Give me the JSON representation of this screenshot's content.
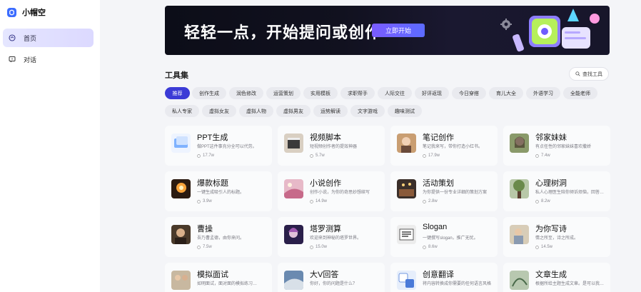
{
  "app": {
    "name": "小帽空"
  },
  "nav": [
    {
      "label": "首页",
      "icon": "home-icon",
      "active": true
    },
    {
      "label": "对话",
      "icon": "chat-icon",
      "active": false
    }
  ],
  "banner": {
    "title": "轻轻一点，开始提问或创作",
    "button": "立即开始"
  },
  "tools": {
    "title": "工具集",
    "search_label": "查找工具",
    "tags_row1": [
      "推荐",
      "创作生成",
      "润色修改",
      "运营策划",
      "实用模板",
      "求职帮手",
      "人际交往",
      "好评返现",
      "今日穿搭",
      "育儿大全",
      "外语学习",
      "全能老师"
    ],
    "tags_row2": [
      "私人专家",
      "虚拟女友",
      "虚拟人物",
      "虚拟男友",
      "运势解读",
      "文字游戏",
      "趣味测试"
    ],
    "cards": [
      {
        "title": "PPT生成",
        "desc": "做PPT这件事充分全可以代劳。",
        "count": "17.7w"
      },
      {
        "title": "视频脚本",
        "desc": "短视频创作者的提效神器",
        "count": "5.7w"
      },
      {
        "title": "笔记创作",
        "desc": "笔记我来写，带你打造小红书。",
        "count": "17.9w"
      },
      {
        "title": "邻家妹妹",
        "desc": "有点任性的邻家妹妹喜欢撒娇",
        "count": "7.4w"
      },
      {
        "title": "爆款标题",
        "desc": "一键生成吸引人的标题。",
        "count": "3.9w"
      },
      {
        "title": "小说创作",
        "desc": "创作小说，为你的奇思妙想续写",
        "count": "14.9w"
      },
      {
        "title": "活动策划",
        "desc": "为你提供一份专业详细的策划方案",
        "count": "2.8w"
      },
      {
        "title": "心理树洞",
        "desc": "私人心理医生陪你倾诉烦恼，回答…",
        "count": "8.2w"
      },
      {
        "title": "曹操",
        "desc": "吾乃曹孟德，由你来问。",
        "count": "7.5w"
      },
      {
        "title": "塔罗测算",
        "desc": "欢迎来到神秘的塔罗世界。",
        "count": "15.0w"
      },
      {
        "title": "Slogan",
        "desc": "一键撰写slogan，推广无忧。",
        "count": "8.6w"
      },
      {
        "title": "为你写诗",
        "desc": "情之所至，诗之所成。",
        "count": "14.5w"
      },
      {
        "title": "模拟面试",
        "desc": "如明面试，面对面的模拟练习…",
        "count": ""
      },
      {
        "title": "大V回答",
        "desc": "你好，你的问题是什么？",
        "count": ""
      },
      {
        "title": "创意翻译",
        "desc": "将内容转换成你需要的任何语言风格",
        "count": ""
      },
      {
        "title": "文章生成",
        "desc": "根据所给主题生成文章。是可以我…",
        "count": ""
      }
    ]
  },
  "colors": {
    "accent": "#3b3bd6",
    "brand": "#3b6cff",
    "banner_bg": "#0c0d18",
    "page_bg": "#f4f5f8"
  }
}
